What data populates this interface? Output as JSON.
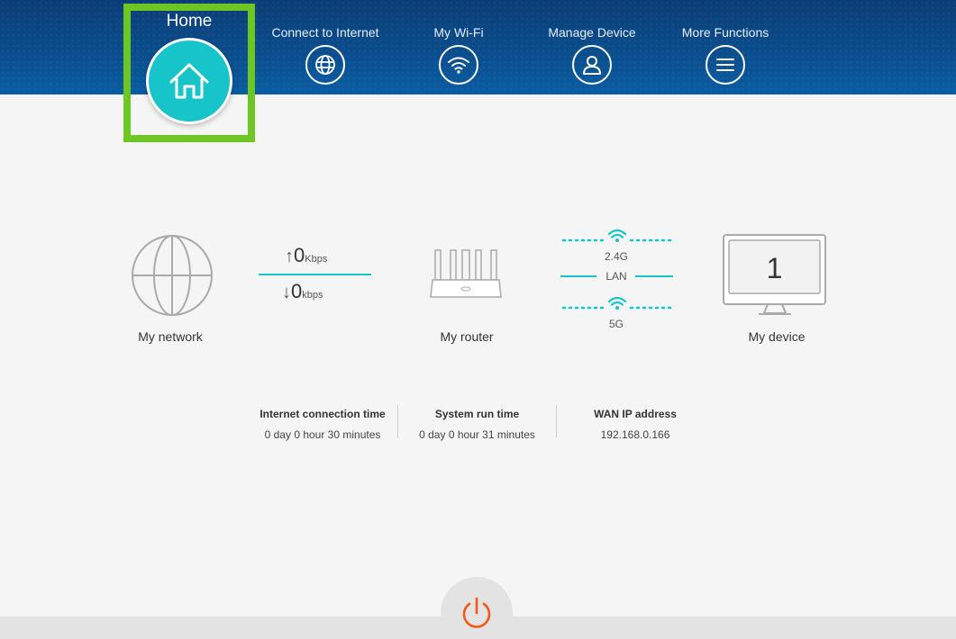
{
  "nav": {
    "home": "Home",
    "items": [
      {
        "label": "Connect to Internet",
        "icon": "globe-icon"
      },
      {
        "label": "My Wi-Fi",
        "icon": "wifi-icon"
      },
      {
        "label": "Manage Device",
        "icon": "user-icon"
      },
      {
        "label": "More Functions",
        "icon": "menu-icon"
      }
    ]
  },
  "diagram": {
    "network_label": "My network",
    "upload_value": "0",
    "upload_unit": "Kbps",
    "download_value": "0",
    "download_unit": "kbps",
    "router_label": "My router",
    "band_24": "2.4G",
    "band_lan": "LAN",
    "band_5": "5G",
    "device_count": "1",
    "device_label": "My device"
  },
  "stats": [
    {
      "title": "Internet connection time",
      "value": "0 day 0 hour 30 minutes"
    },
    {
      "title": "System run time",
      "value": "0 day 0 hour 31 minutes"
    },
    {
      "title": "WAN IP address",
      "value": "192.168.0.166"
    }
  ],
  "colors": {
    "accent": "#17c4c9",
    "highlight": "#6cc723",
    "power": "#f05a1a",
    "header": "#0a4f8f"
  }
}
